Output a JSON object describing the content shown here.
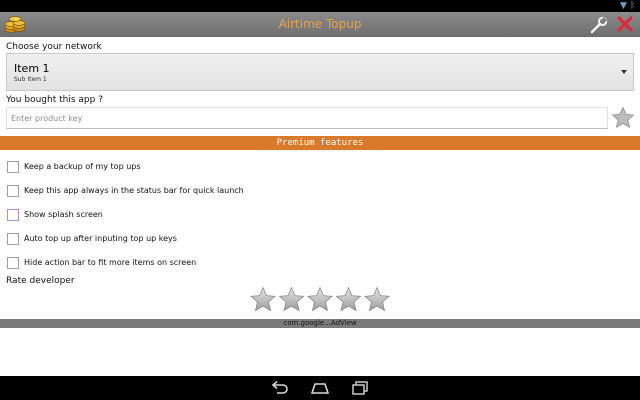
{
  "app": {
    "title": "Airtime Topup"
  },
  "network": {
    "label": "Choose your network",
    "selected_title": "Item 1",
    "selected_subtitle": "Sub Item 1"
  },
  "product_key": {
    "label": "You bought this app ?",
    "placeholder": "Enter product key",
    "value": ""
  },
  "premium": {
    "header": "Premium features",
    "options": [
      {
        "label": "Keep a backup of my top ups",
        "checked": false
      },
      {
        "label": "Keep this app always in the status bar for quick launch",
        "checked": false
      },
      {
        "label": "Show splash screen",
        "checked": false
      },
      {
        "label": "Auto top up after inputing top up keys",
        "checked": false
      },
      {
        "label": "Hide action bar to fit more items on screen",
        "checked": false
      }
    ]
  },
  "rate": {
    "label": "Rate developer",
    "max_stars": 5,
    "rating": 0
  },
  "ad": {
    "text": "com.google...AdView"
  },
  "colors": {
    "accent": "#d97a2b",
    "title_text": "#e8a14a",
    "close_red": "#e0283a"
  },
  "icons": {
    "app_logo": "coins-icon",
    "settings": "wrench-icon",
    "close": "close-icon",
    "back": "back-icon",
    "home": "home-icon",
    "recents": "recents-icon"
  }
}
